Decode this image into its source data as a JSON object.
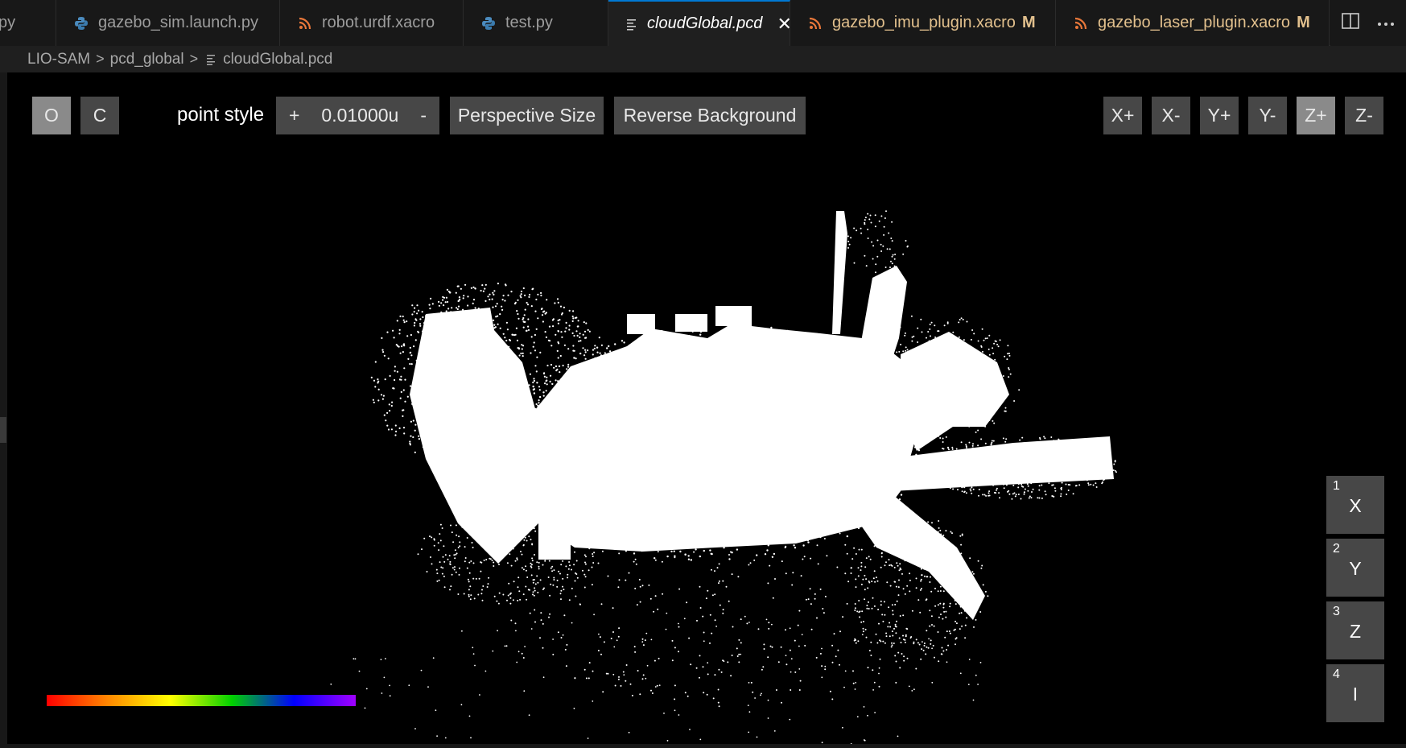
{
  "tabs": [
    {
      "label": "py",
      "icon": "python-icon",
      "modified": false,
      "active": false
    },
    {
      "label": "gazebo_sim.launch.py",
      "icon": "python-icon",
      "modified": false,
      "active": false
    },
    {
      "label": "robot.urdf.xacro",
      "icon": "rss-icon",
      "modified": false,
      "active": false
    },
    {
      "label": "test.py",
      "icon": "python-icon",
      "modified": false,
      "active": false
    },
    {
      "label": "cloudGlobal.pcd",
      "icon": "file-lines-icon",
      "modified": false,
      "active": true
    },
    {
      "label": "gazebo_imu_plugin.xacro",
      "icon": "rss-icon",
      "modified": true,
      "active": false
    },
    {
      "label": "gazebo_laser_plugin.xacro",
      "icon": "rss-icon",
      "modified": true,
      "active": false
    }
  ],
  "modified_flag": "M",
  "breadcrumb": [
    "LIO-SAM",
    "pcd_global",
    "cloudGlobal.pcd"
  ],
  "toolbar": {
    "o_label": "O",
    "c_label": "C",
    "point_style_label": "point style",
    "plus_label": "+",
    "point_size_value": "0.01000u",
    "minus_label": "-",
    "perspective_label": "Perspective Size",
    "reverse_bg_label": "Reverse Background"
  },
  "view_buttons": [
    "X+",
    "X-",
    "Y+",
    "Y-",
    "Z+",
    "Z-"
  ],
  "active_view": "Z+",
  "axis_buttons": [
    {
      "num": "1",
      "axis": "X"
    },
    {
      "num": "2",
      "axis": "Y"
    },
    {
      "num": "3",
      "axis": "Z"
    },
    {
      "num": "4",
      "axis": "I"
    }
  ],
  "colors": {
    "accent": "#0078d4",
    "modified": "#e2c08d",
    "python_icon": "#4b8bbe",
    "rss_icon": "#e8773a",
    "point_color": "#ffffff",
    "background": "#000000"
  }
}
